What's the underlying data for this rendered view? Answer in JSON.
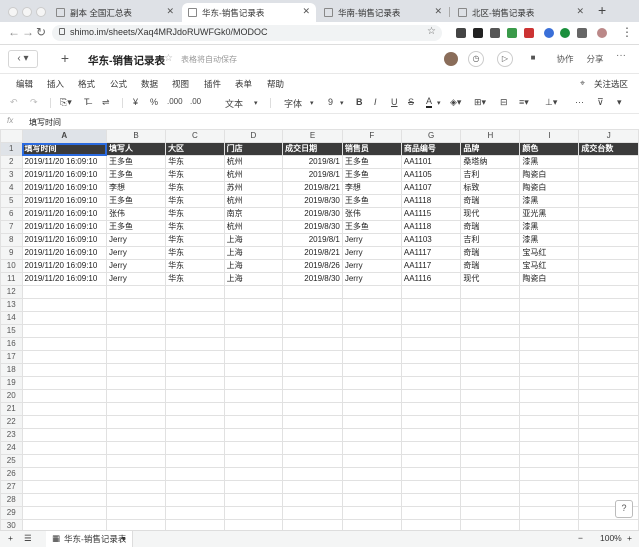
{
  "browser": {
    "tabs": [
      {
        "title": "副本 全国汇总表",
        "active": false
      },
      {
        "title": "华东-销售记录表",
        "active": true
      },
      {
        "title": "华南-销售记录表",
        "active": false
      },
      {
        "title": "北区-销售记录表",
        "active": false
      }
    ],
    "url": "shimo.im/sheets/Xaq4MRJdoRUWFGk0/MODOC",
    "new_tab": "+"
  },
  "app": {
    "doc_title": "华东-销售记录表",
    "autosave": "表格将自动保存",
    "collab_label": "协作",
    "share_label": "分享",
    "menu": [
      "编辑",
      "插入",
      "格式",
      "公式",
      "数据",
      "视图",
      "插件",
      "表单",
      "帮助"
    ],
    "focus_label": "关注选区",
    "toolbar": {
      "currency": "¥",
      "percent": "%",
      "decimal": ".000",
      "decimal2": ".00",
      "format_text": "文本",
      "font": "字体",
      "font_size": "9",
      "bold": "B",
      "italic": "I",
      "underline": "U",
      "strike": "S",
      "font_color": "A"
    }
  },
  "formula_bar": {
    "fx": "fx",
    "value": "填写时间"
  },
  "sheet": {
    "columns": [
      "A",
      "B",
      "C",
      "D",
      "E",
      "F",
      "G",
      "H",
      "I",
      "J"
    ],
    "header": [
      "填写时间",
      "填写人",
      "大区",
      "门店",
      "成交日期",
      "销售员",
      "商品编号",
      "品牌",
      "颜色",
      "成交台数"
    ],
    "rows": [
      [
        "2019/11/20 16:09:10",
        "王多鱼",
        "华东",
        "杭州",
        "2019/8/1",
        "王多鱼",
        "AA1101",
        "桑塔纳",
        "漆黑",
        ""
      ],
      [
        "2019/11/20 16:09:10",
        "王多鱼",
        "华东",
        "杭州",
        "2019/8/1",
        "王多鱼",
        "AA1105",
        "吉利",
        "陶瓷白",
        ""
      ],
      [
        "2019/11/20 16:09:10",
        "李想",
        "华东",
        "苏州",
        "2019/8/21",
        "李想",
        "AA1107",
        "标致",
        "陶瓷白",
        ""
      ],
      [
        "2019/11/20 16:09:10",
        "王多鱼",
        "华东",
        "杭州",
        "2019/8/30",
        "王多鱼",
        "AA1118",
        "奇瑞",
        "漆黑",
        ""
      ],
      [
        "2019/11/20 16:09:10",
        "张伟",
        "华东",
        "南京",
        "2019/8/30",
        "张伟",
        "AA1115",
        "现代",
        "亚光黑",
        ""
      ],
      [
        "2019/11/20 16:09:10",
        "王多鱼",
        "华东",
        "杭州",
        "2019/8/30",
        "王多鱼",
        "AA1118",
        "奇瑞",
        "漆黑",
        ""
      ],
      [
        "2019/11/20 16:09:10",
        "Jerry",
        "华东",
        "上海",
        "2019/8/1",
        "Jerry",
        "AA1103",
        "吉利",
        "漆黑",
        ""
      ],
      [
        "2019/11/20 16:09:10",
        "Jerry",
        "华东",
        "上海",
        "2019/8/21",
        "Jerry",
        "AA1117",
        "奇瑞",
        "宝马红",
        ""
      ],
      [
        "2019/11/20 16:09:10",
        "Jerry",
        "华东",
        "上海",
        "2019/8/26",
        "Jerry",
        "AA1117",
        "奇瑞",
        "宝马红",
        ""
      ],
      [
        "2019/11/20 16:09:10",
        "Jerry",
        "华东",
        "上海",
        "2019/8/30",
        "Jerry",
        "AA1116",
        "现代",
        "陶瓷白",
        ""
      ]
    ],
    "total_rows": 31,
    "sheet_tab": "华东-销售记录表",
    "zoom": "100%"
  },
  "colors": {
    "header_bg": "#3b3b3b",
    "selection": "#2b6be0"
  }
}
